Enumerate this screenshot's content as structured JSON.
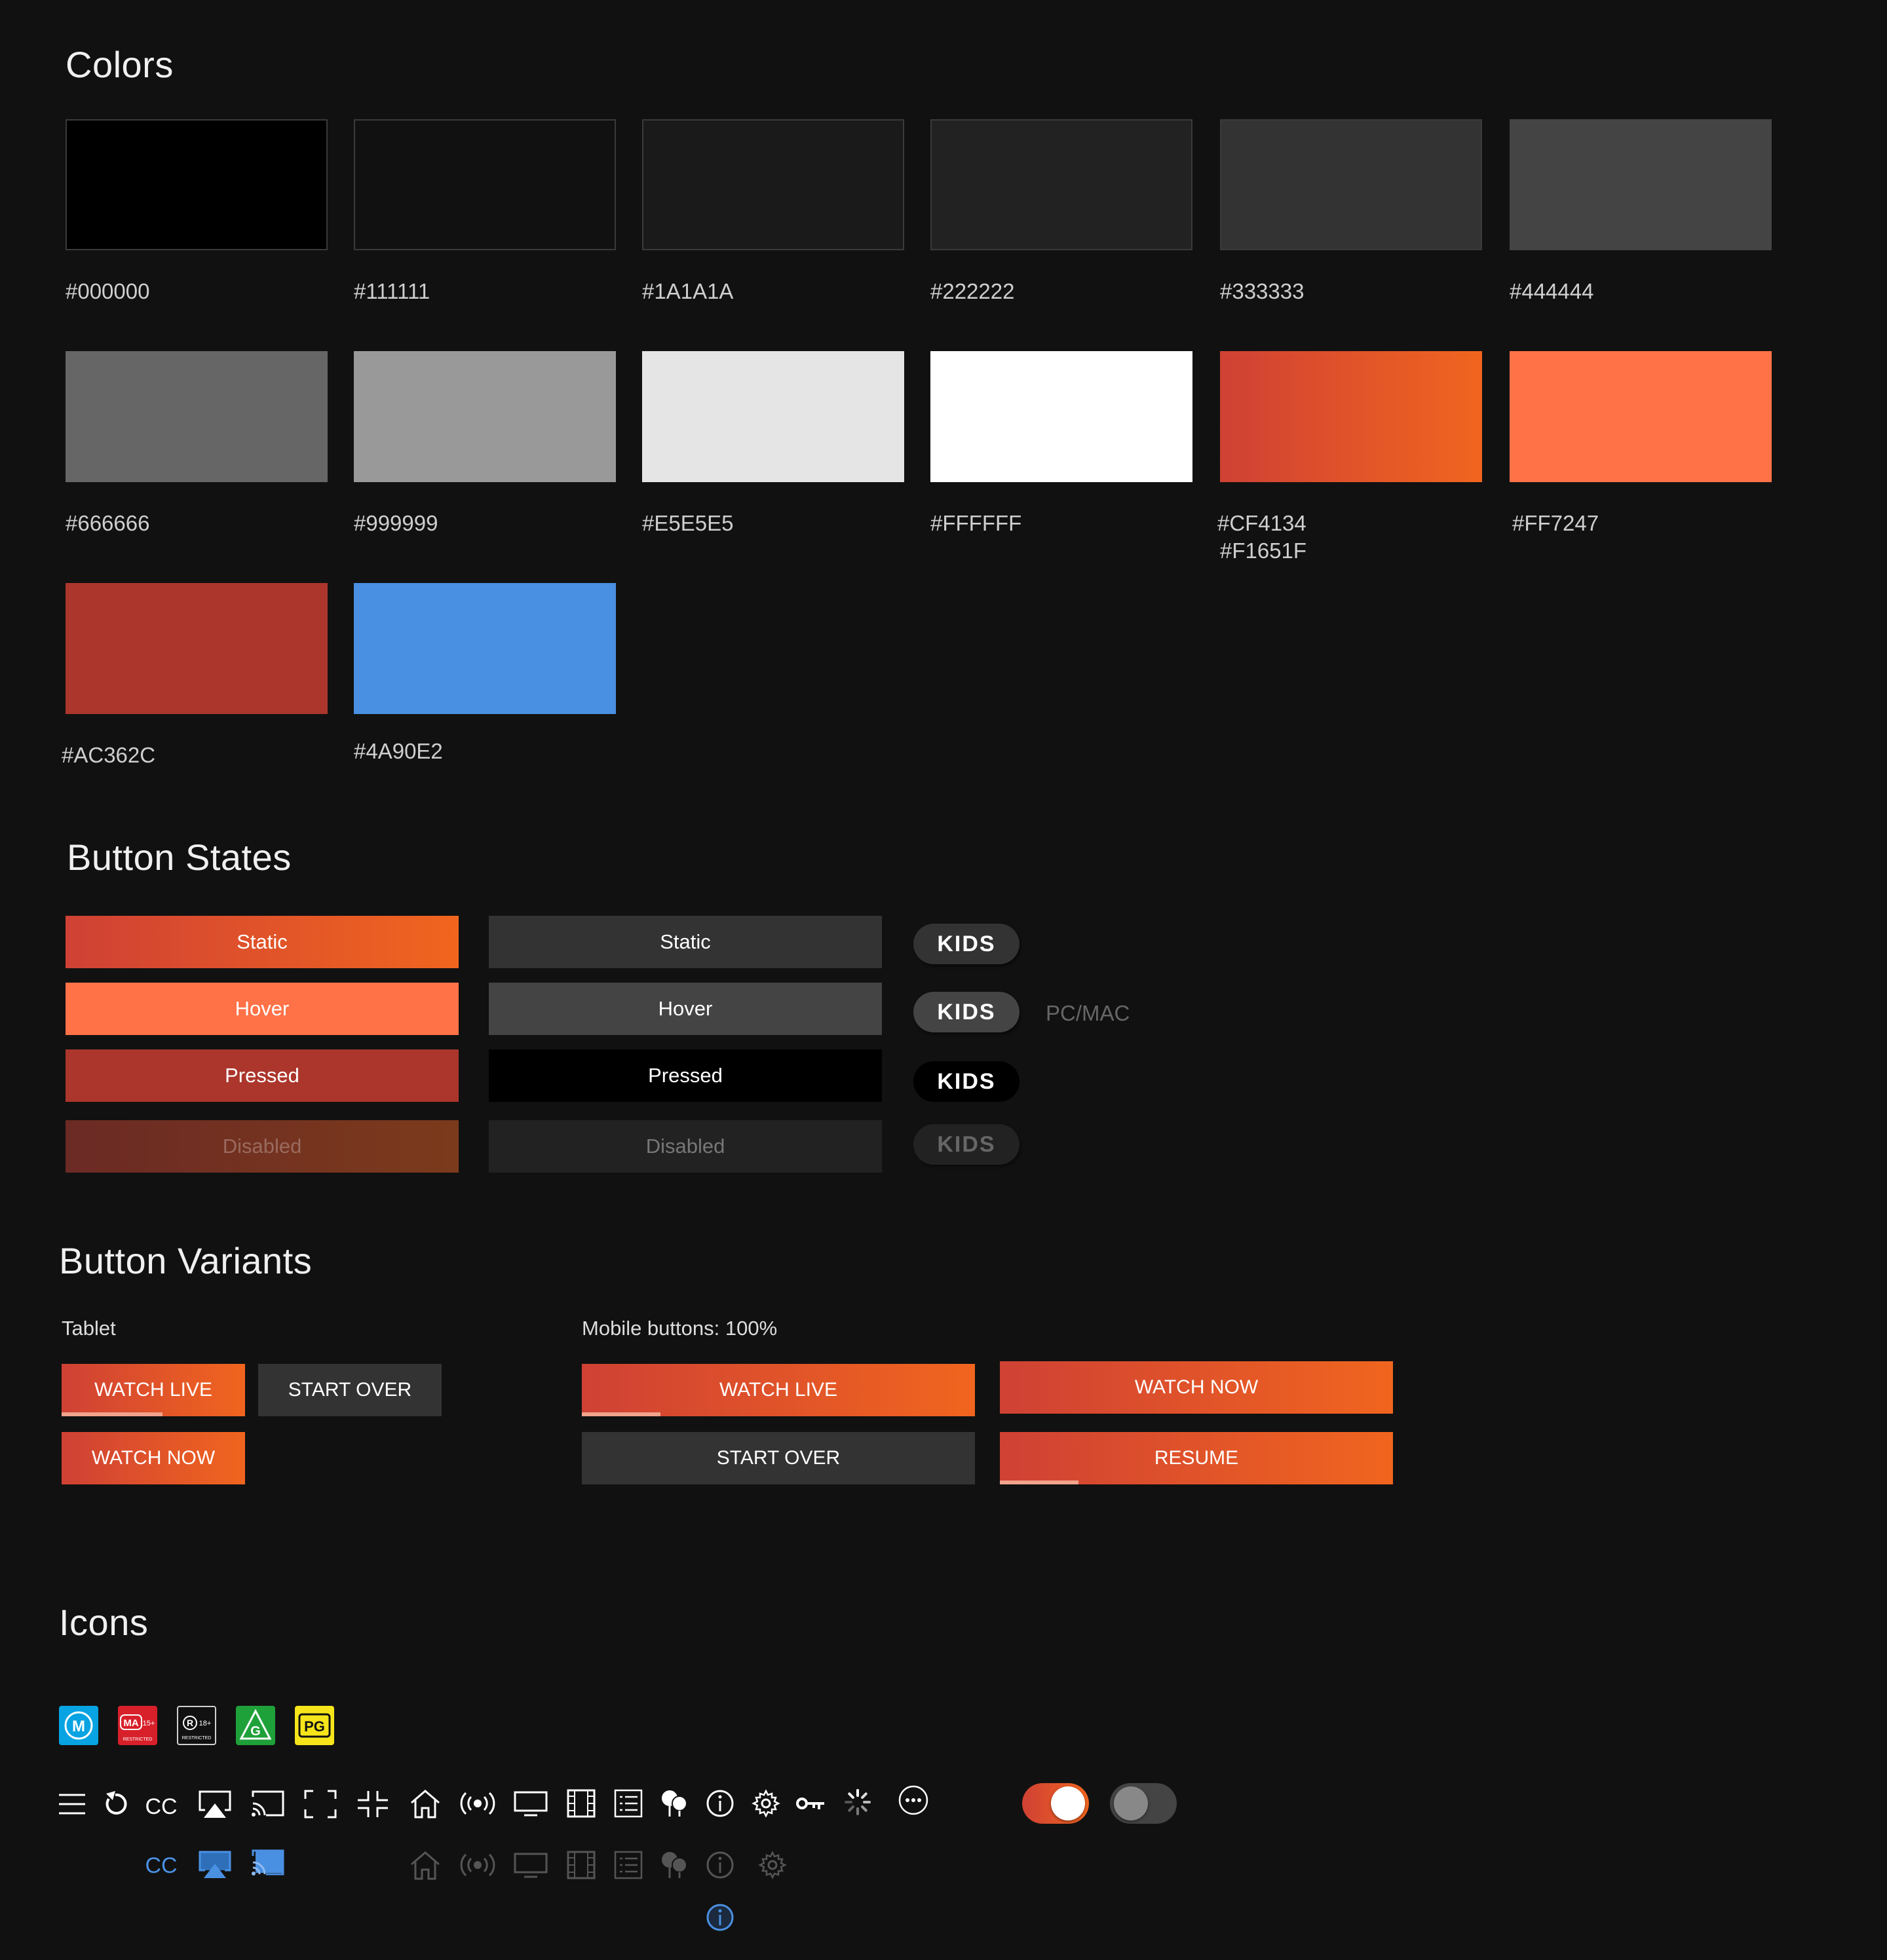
{
  "colors_section": {
    "title": "Colors",
    "swatches": [
      {
        "label": "#000000",
        "color": "#000000"
      },
      {
        "label": "#111111",
        "color": "#111111"
      },
      {
        "label": "#1A1A1A",
        "color": "#1A1A1A"
      },
      {
        "label": "#222222",
        "color": "#222222"
      },
      {
        "label": "#333333",
        "color": "#333333"
      },
      {
        "label": "#444444",
        "color": "#444444"
      },
      {
        "label": "#666666",
        "color": "#666666"
      },
      {
        "label": "#999999",
        "color": "#999999"
      },
      {
        "label": "#E5E5E5",
        "color": "#E5E5E5"
      },
      {
        "label": "#FFFFFF",
        "color": "#FFFFFF"
      },
      {
        "label": "#CF4134",
        "label2": "#F1651F",
        "color": "#CF4134",
        "color2": "#F1651F"
      },
      {
        "label": "#FF7247",
        "color": "#FF7247"
      },
      {
        "label": "#AC362C",
        "color": "#AC362C"
      },
      {
        "label": "#4A90E2",
        "color": "#4A90E2"
      }
    ]
  },
  "button_states": {
    "title": "Button States",
    "primary": {
      "static": "Static",
      "hover": "Hover",
      "pressed": "Pressed",
      "disabled": "Disabled"
    },
    "secondary": {
      "static": "Static",
      "hover": "Hover",
      "pressed": "Pressed",
      "disabled": "Disabled"
    },
    "kids": {
      "label": "KIDS",
      "platform_note": "PC/MAC"
    }
  },
  "button_variants": {
    "title": "Button Variants",
    "tablet": {
      "label": "Tablet",
      "watch_live": "WATCH LIVE",
      "start_over": "START OVER",
      "watch_now": "WATCH NOW",
      "watch_live_progress": 0.55
    },
    "mobile": {
      "label": "Mobile buttons: 100%",
      "watch_live": "WATCH LIVE",
      "start_over": "START OVER",
      "watch_now": "WATCH NOW",
      "resume": "RESUME",
      "watch_live_progress": 0.2,
      "resume_progress": 0.2
    }
  },
  "icons_section": {
    "title": "Icons",
    "ratings": {
      "m": "M",
      "ma": "MA",
      "ma_age": "15+",
      "ma_sub": "RESTRICTED",
      "r": "R",
      "r_age": "18+",
      "r_sub": "RESTRICTED",
      "g": "G",
      "pg": "PG"
    },
    "cc_label": "CC",
    "icon_names": [
      "menu-icon",
      "replay-icon",
      "cc-icon",
      "airplay-icon",
      "cast-icon",
      "fullscreen-icon",
      "exit-fullscreen-icon",
      "home-icon",
      "live-icon",
      "tv-icon",
      "film-icon",
      "list-icon",
      "categories-icon",
      "info-icon",
      "settings-icon",
      "key-icon",
      "loading-icon",
      "more-icon"
    ],
    "toggle_on": true,
    "toggle_off": false,
    "accent_blue": "#4A90E2",
    "accent_orange": "#F1651F"
  }
}
